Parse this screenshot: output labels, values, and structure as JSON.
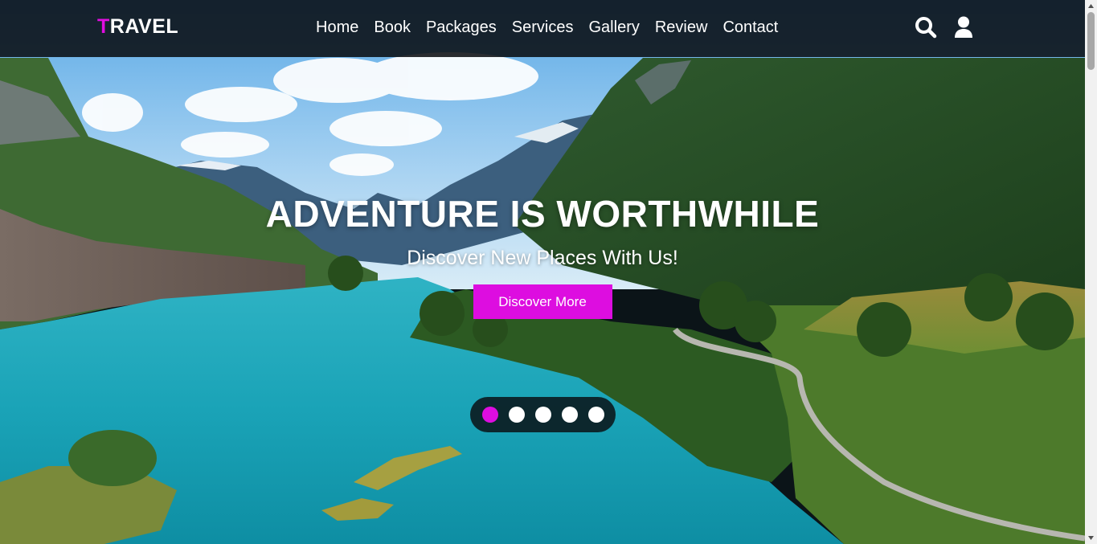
{
  "brand": {
    "first_letter": "T",
    "rest": "RAVEL"
  },
  "nav": {
    "items": [
      "Home",
      "Book",
      "Packages",
      "Services",
      "Gallery",
      "Review",
      "Contact"
    ]
  },
  "header_icons": {
    "search": "search-icon",
    "user": "user-icon"
  },
  "hero": {
    "title": "ADVENTURE IS WORTHWHILE",
    "subtitle": "Discover New Places With Us!",
    "cta_label": "Discover More"
  },
  "slider": {
    "count": 5,
    "active_index": 0
  },
  "colors": {
    "accent": "#dd0de0",
    "header_bg": "#080a0e",
    "text": "#ffffff"
  }
}
